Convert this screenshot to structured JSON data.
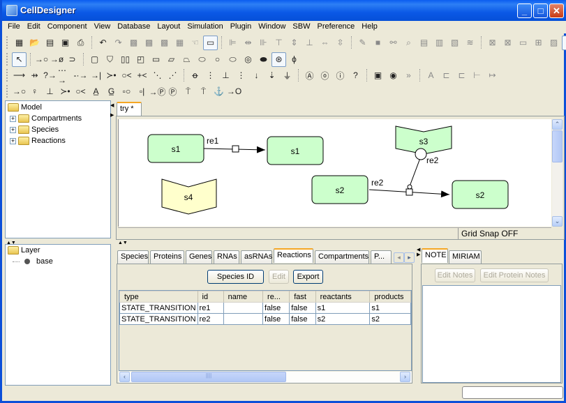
{
  "window": {
    "title": "CellDesigner",
    "buttons": {
      "minimize": "_",
      "maximize": "□",
      "close": "X"
    }
  },
  "menu": [
    "File",
    "Edit",
    "Component",
    "View",
    "Database",
    "Layout",
    "Simulation",
    "Plugin",
    "Window",
    "SBW",
    "Preference",
    "Help"
  ],
  "toolbars": {
    "row1_left": [
      "new-icon",
      "open-icon",
      "open-recent-icon",
      "save-icon",
      "print-icon"
    ],
    "row1_edit": [
      "undo-icon",
      "redo-icon",
      "copy-icon",
      "paste-icon",
      "cut-icon",
      "select-all-icon",
      "hand-icon",
      "zoom-fit-icon"
    ],
    "row1_align": [
      "align-left-icon",
      "align-center-icon",
      "align-right-icon",
      "align-top-icon",
      "align-middle-icon",
      "align-bottom-icon",
      "distribute-h-icon",
      "distribute-v-icon"
    ],
    "row1_misc": [
      "brush-icon",
      "block-icon",
      "link-icon",
      "find-icon",
      "note-icon",
      "layers-icon",
      "stack-icon",
      "chain-icon"
    ],
    "row1_view": [
      "frame-icon",
      "frame-cross-icon",
      "window-icon",
      "grid-icon",
      "pattern-icon",
      "route-icon"
    ],
    "row2_species": [
      "select-pointer-icon",
      "receptor-icon",
      "ion-channel-icon",
      "truncated-protein-icon",
      "generic-protein-icon",
      "receptor-shape-icon",
      "ion-channel-shape-icon",
      "gene-icon",
      "rna-icon",
      "as-rna-icon",
      "phenotype-icon",
      "ion-icon",
      "simple-molecule-icon",
      "degraded-icon",
      "complex-icon",
      "unknown-icon",
      "drug-icon",
      "empty-set-icon"
    ],
    "row3_reactions": [
      "state-transition-icon",
      "known-transition-omitted-icon",
      "unknown-transition-icon",
      "transcription-icon",
      "translation-icon",
      "transport-icon",
      "heterodimer-association-icon",
      "dissociation-icon",
      "truncation-icon",
      "unknown-catalysis-line-icon",
      "unknown-inhibition-line-icon",
      "catalysis-icon",
      "unknown-catalysis-icon",
      "inhibition-icon",
      "unknown-inhibition-icon",
      "transcriptional-activation-icon",
      "transcriptional-inhibition-icon",
      "translational-activation-icon",
      "and-gate-icon",
      "or-gate-icon",
      "not-gate-icon",
      "unknown-gate-icon",
      "compartment-square-icon",
      "compartment-oval-icon",
      "compartment-more-icon",
      "text-label-icon",
      "align-text-1-icon",
      "align-text-2-icon",
      "align-text-3-icon",
      "align-text-4-icon"
    ],
    "row4_modifiers": [
      "add-reactant-icon",
      "add-reactant-branch-icon",
      "add-product-icon",
      "association-icon",
      "dissociation-icon",
      "catalysis-a-icon",
      "catalysis-g-icon",
      "residue-icon",
      "binding-site-icon",
      "phosphorylate-arrow-icon",
      "phosphorylate-icon",
      "anchor-top-icon",
      "anchor-top-2-icon",
      "anchor-bottom-icon",
      "plug-icon"
    ]
  },
  "model_tree": {
    "root": "Model",
    "children": [
      "Compartments",
      "Species",
      "Reactions"
    ]
  },
  "layer_tree": {
    "root": "Layer",
    "children": [
      "base"
    ]
  },
  "editor": {
    "tab": "try *",
    "status": "Grid Snap OFF",
    "nodes": [
      {
        "id": "s1a",
        "label": "s1",
        "shape": "rounded",
        "color": "#ccffcc"
      },
      {
        "id": "s1b",
        "label": "s1",
        "shape": "rounded",
        "color": "#ccffcc"
      },
      {
        "id": "s2a",
        "label": "s2",
        "shape": "rounded",
        "color": "#ccffcc"
      },
      {
        "id": "s2b",
        "label": "s2",
        "shape": "rounded",
        "color": "#ccffcc"
      },
      {
        "id": "s3",
        "label": "s3",
        "shape": "receptor",
        "color": "#ccffcc"
      },
      {
        "id": "s4",
        "label": "s4",
        "shape": "receptor",
        "color": "#ffffcc"
      }
    ],
    "reactions": [
      {
        "label": "re1",
        "from": "s1",
        "to": "s1"
      },
      {
        "label": "re2",
        "from": "s2",
        "to": "s2",
        "modifier": "s3",
        "modifier_label": "re2"
      }
    ]
  },
  "bottom_tabs": [
    "Species",
    "Proteins",
    "Genes",
    "RNAs",
    "asRNAs",
    "Reactions",
    "Compartments",
    "P..."
  ],
  "bottom_active_tab": "Reactions",
  "bottom_buttons": {
    "species_id": "Species ID",
    "edit": "Edit",
    "export": "Export"
  },
  "reactions_table": {
    "columns": [
      "type",
      "id",
      "name",
      "re...",
      "fast",
      "reactants",
      "products"
    ],
    "rows": [
      [
        "STATE_TRANSITION",
        "re1",
        "",
        "false",
        "false",
        "s1",
        "s1"
      ],
      [
        "STATE_TRANSITION",
        "re2",
        "",
        "false",
        "false",
        "s2",
        "s2"
      ]
    ]
  },
  "notes_tabs": [
    "NOTE",
    "MIRIAM"
  ],
  "notes_active_tab": "NOTE",
  "notes_buttons": {
    "edit_notes": "Edit Notes",
    "edit_protein_notes": "Edit Protein Notes"
  }
}
